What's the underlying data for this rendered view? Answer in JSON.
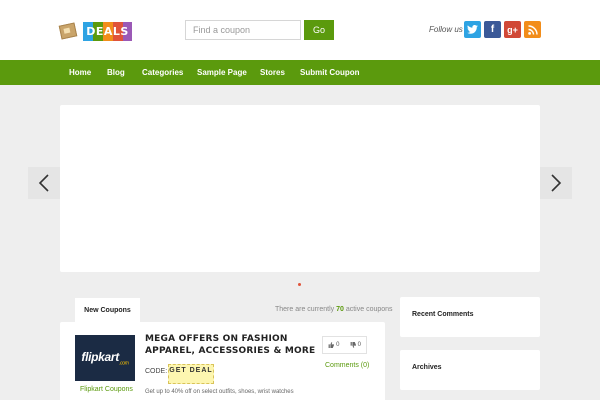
{
  "header": {
    "logo_text": "DEALS",
    "search_placeholder": "Find a coupon",
    "search_button": "Go",
    "follow_label": "Follow us :",
    "social": [
      {
        "name": "twitter",
        "glyph": "t",
        "color": "#2ea3e3"
      },
      {
        "name": "facebook",
        "glyph": "f",
        "color": "#3b5998"
      },
      {
        "name": "google-plus",
        "glyph": "g+",
        "color": "#d14836"
      },
      {
        "name": "rss",
        "glyph": "",
        "color": "#f28d1a"
      }
    ]
  },
  "nav": {
    "items": [
      "Home",
      "Blog",
      "Categories",
      "Sample Page",
      "Stores",
      "Submit Coupon"
    ]
  },
  "slider": {
    "prev_icon": "chevron-left-icon",
    "next_icon": "chevron-right-icon",
    "active_dot_color": "#e0533a"
  },
  "coupons": {
    "tab_label": "New Coupons",
    "active_prefix": "There are currently ",
    "active_count": "70",
    "active_suffix": " active coupons",
    "items": [
      {
        "store_logo_text": "flipkart",
        "store_logo_suffix": ".com",
        "store_link": "Flipkart Coupons",
        "title": "MEGA OFFERS ON FASHION APPAREL, ACCESSORIES & MORE",
        "code_label": "CODE:",
        "code_button": "GET DEAL",
        "description": "Get up to 40% off on select outfits, shoes, wrist watches",
        "votes_up": "0",
        "votes_down": "0",
        "comments": "Comments (0)"
      }
    ]
  },
  "sidebar": {
    "recent_comments": "Recent Comments",
    "archives": "Archives"
  },
  "colors": {
    "brand_green": "#5b9a0d",
    "background": "#eeeeee"
  }
}
